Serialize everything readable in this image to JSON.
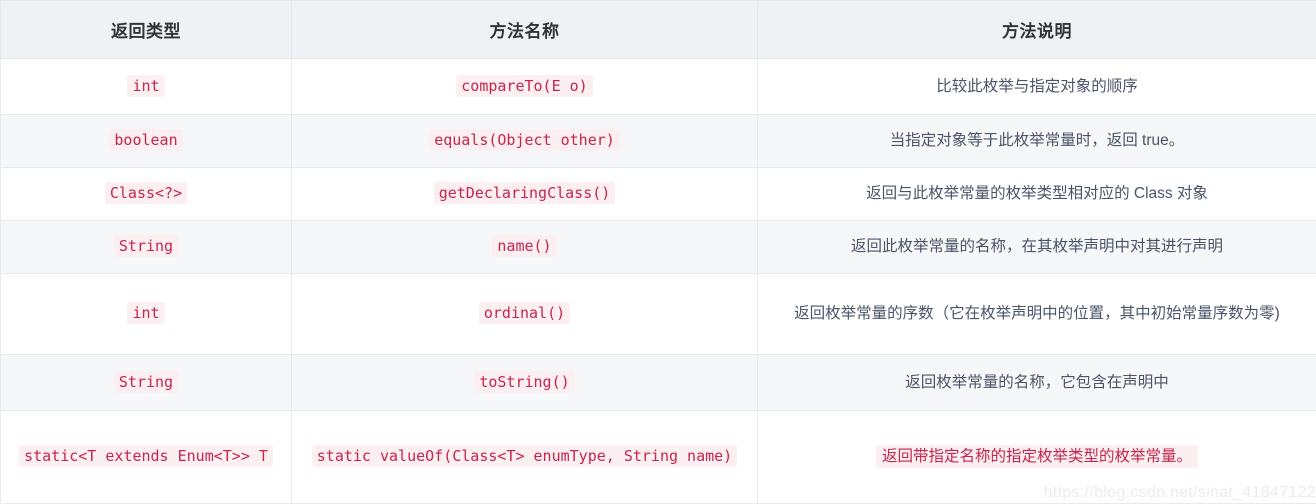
{
  "table": {
    "headers": [
      {
        "label": "返回类型"
      },
      {
        "label": "方法名称"
      },
      {
        "label": "方法说明"
      }
    ],
    "rows": [
      {
        "return_type": "int",
        "method": "compareTo(E o)",
        "description": "比较此枚举与指定对象的顺序",
        "description_is_code": false
      },
      {
        "return_type": "boolean",
        "method": "equals(Object other)",
        "description": "当指定对象等于此枚举常量时，返回 true。",
        "description_is_code": false
      },
      {
        "return_type": "Class<?>",
        "method": "getDeclaringClass()",
        "description": "返回与此枚举常量的枚举类型相对应的 Class 对象",
        "description_is_code": false
      },
      {
        "return_type": "String",
        "method": "name()",
        "description": "返回此枚举常量的名称，在其枚举声明中对其进行声明",
        "description_is_code": false
      },
      {
        "return_type": "int",
        "method": "ordinal()",
        "description": "返回枚举常量的序数（它在枚举声明中的位置，其中初始常量序数为零)",
        "description_is_code": false
      },
      {
        "return_type": "String",
        "method": "toString()",
        "description": "返回枚举常量的名称，它包含在声明中",
        "description_is_code": false
      },
      {
        "return_type": "static<T extends Enum<T>> T",
        "method": "static valueOf(Class<T> enumType, String name)",
        "description": "返回带指定名称的指定枚举类型的枚举常量。",
        "description_is_code": true
      }
    ]
  },
  "watermark": {
    "text": "https://blog.csdn.net/sinat_41847122"
  },
  "colors": {
    "header_bg": "#eef2f5",
    "header_text": "#2f3438",
    "stripe_bg": "#f6f7f8",
    "border": "#e8eaec",
    "code_text": "#c7254e",
    "code_bg": "#fbeff2",
    "body_text": "#4a5568",
    "watermark": "#e9ebed"
  }
}
